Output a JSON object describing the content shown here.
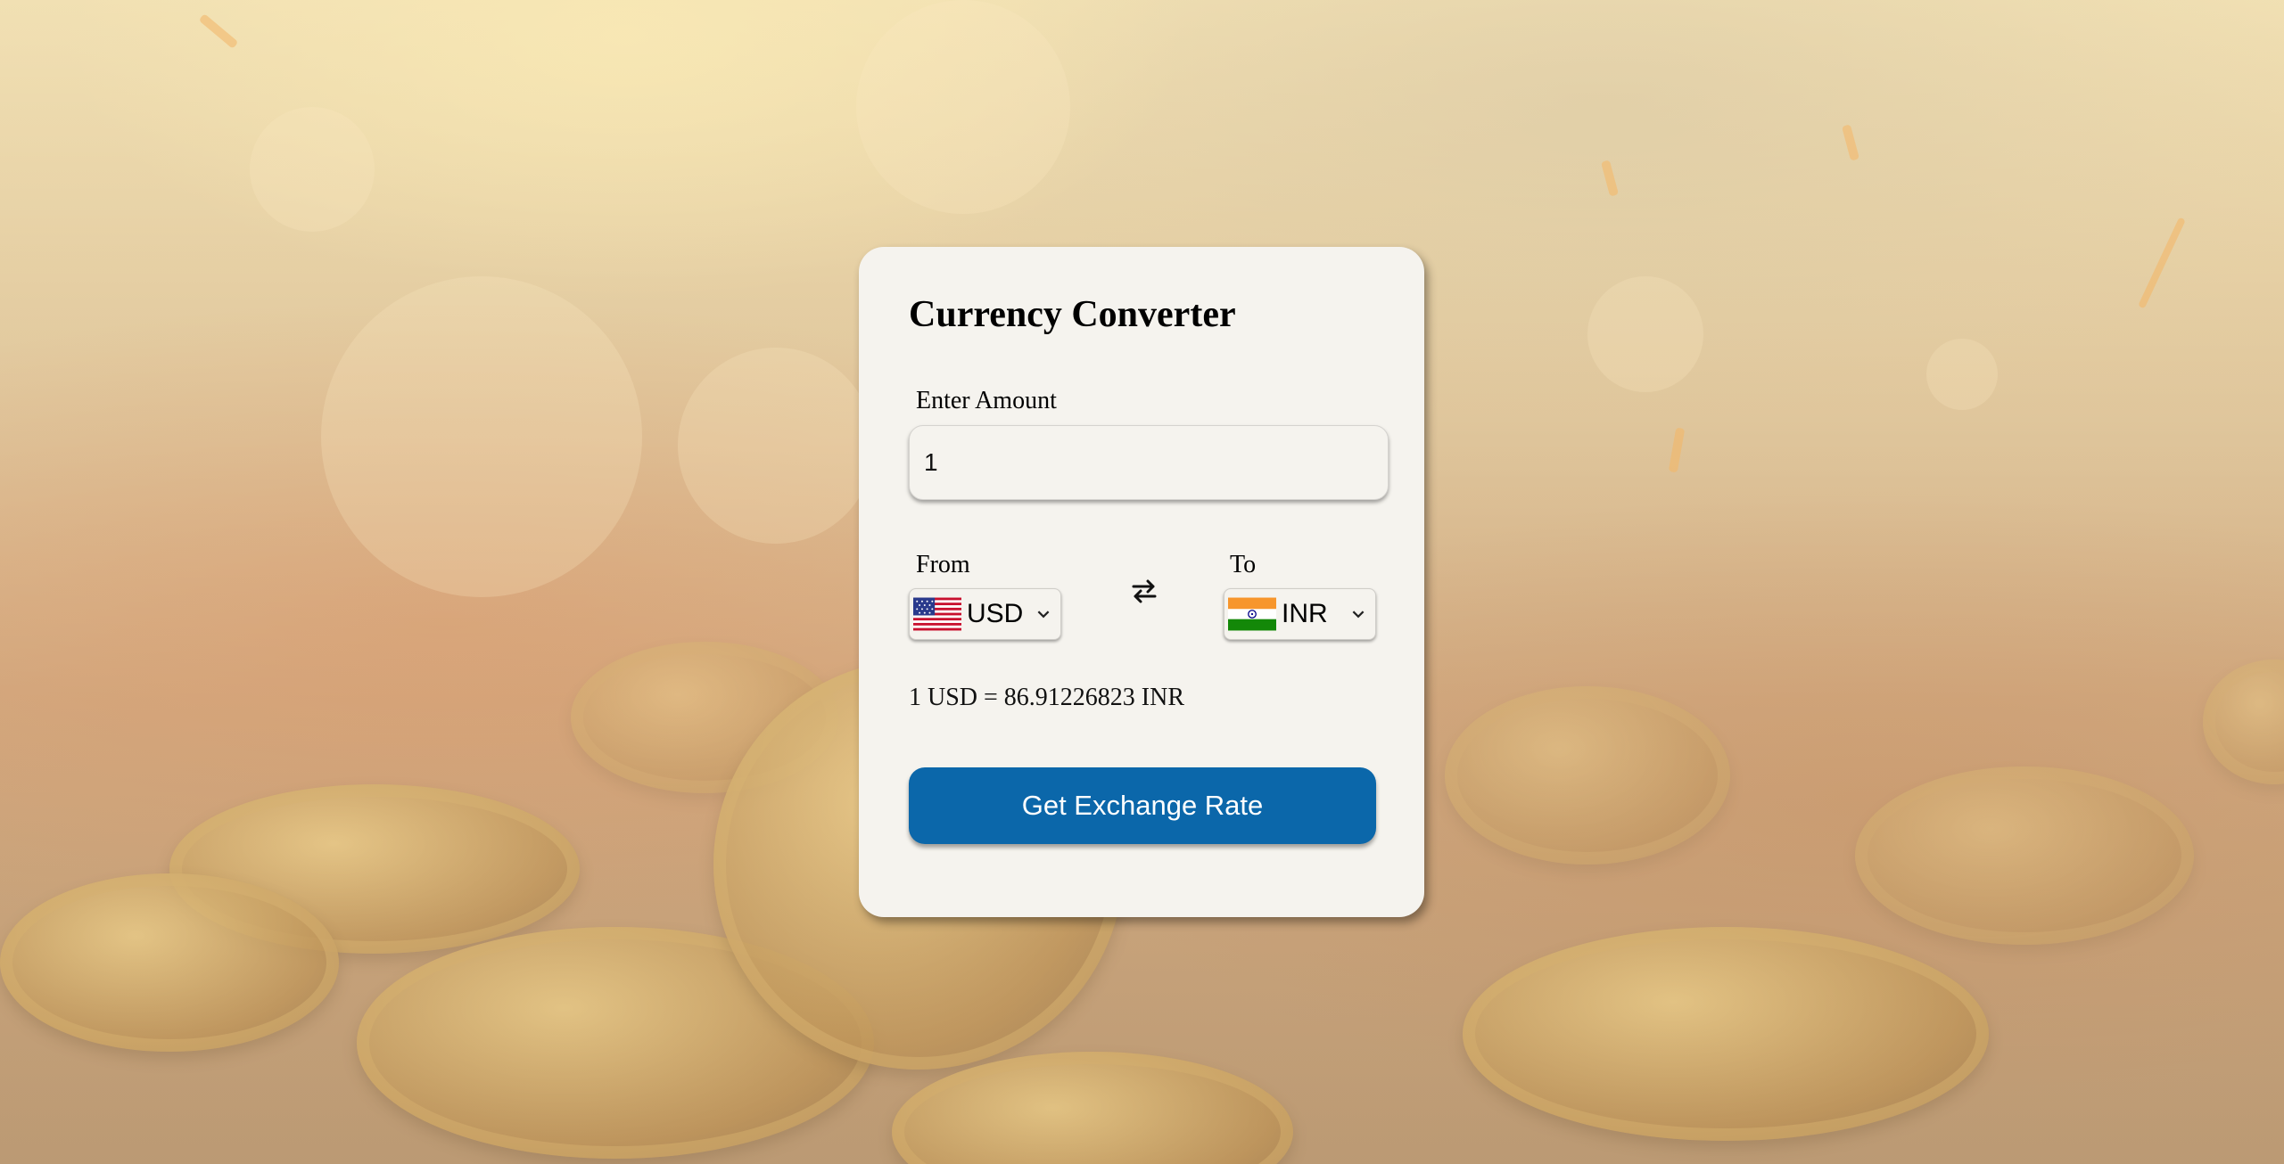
{
  "app": {
    "title": "Currency Converter"
  },
  "amount": {
    "label": "Enter Amount",
    "value": "1"
  },
  "from": {
    "label": "From",
    "currency": "USD",
    "flag_icon": "us-flag-icon"
  },
  "to": {
    "label": "To",
    "currency": "INR",
    "flag_icon": "india-flag-icon"
  },
  "swap_icon": "swap-arrows-icon",
  "result": {
    "text": "1 USD = 86.91226823 INR"
  },
  "action": {
    "button_label": "Get Exchange Rate"
  },
  "colors": {
    "button": "#0b67aa",
    "card": "#f5f3ee"
  }
}
